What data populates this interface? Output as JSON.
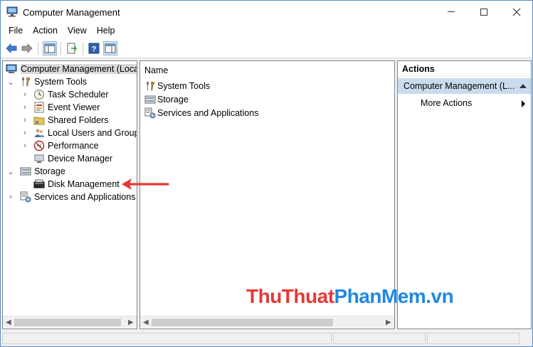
{
  "window": {
    "title": "Computer Management"
  },
  "menu": [
    "File",
    "Action",
    "View",
    "Help"
  ],
  "toolbar": {
    "buttons": [
      "back-icon",
      "forward-icon",
      "show-hide-console-tree-icon",
      "export-list-icon",
      "help-icon",
      "show-hide-action-pane-icon"
    ]
  },
  "tree": {
    "root": "Computer Management (Local",
    "system_tools": "System Tools",
    "task_scheduler": "Task Scheduler",
    "event_viewer": "Event Viewer",
    "shared_folders": "Shared Folders",
    "local_users": "Local Users and Groups",
    "performance": "Performance",
    "device_manager": "Device Manager",
    "storage": "Storage",
    "disk_management": "Disk Management",
    "services_apps": "Services and Applications"
  },
  "list": {
    "header": "Name",
    "items": [
      "System Tools",
      "Storage",
      "Services and Applications"
    ]
  },
  "actions": {
    "title": "Actions",
    "section": "Computer Management (L...",
    "more": "More Actions"
  },
  "watermark": {
    "part1": "ThuThuat",
    "part2": "PhanMem",
    "part3": ".vn"
  },
  "colors": {
    "selection": "#c9dcee",
    "arrow": "#e53935",
    "watermark_red": "#e53935",
    "watermark_blue": "#1e88e5"
  }
}
